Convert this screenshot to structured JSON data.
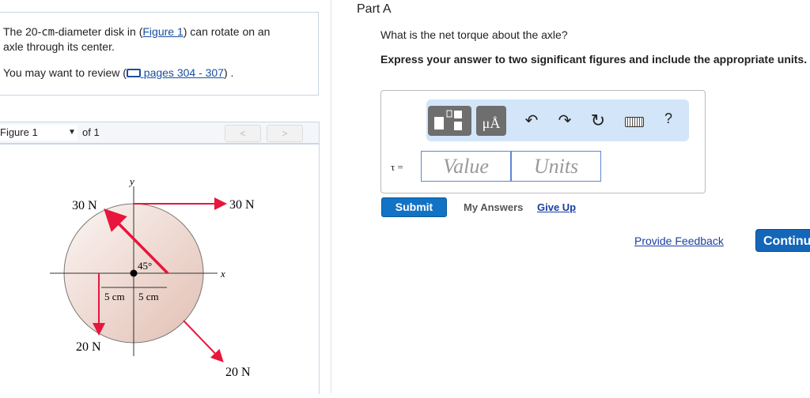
{
  "intro": {
    "line1a": "The 20-",
    "line1b": "cm",
    "line1c": "-diameter disk in (",
    "figure_link": "Figure 1",
    "line1d": ") can rotate on an",
    "line2": "axle through its center.",
    "review_a": "You may want to review (",
    "review_link": " pages 304 - 307",
    "review_b": ") ."
  },
  "figure_bar": {
    "select": "Figure 1",
    "of": "of 1",
    "prev": "<",
    "next": ">"
  },
  "diagram": {
    "y_axis": "y",
    "x_axis": "x",
    "f1": "30 N",
    "f2": "30 N",
    "f3": "20 N",
    "f4": "20 N",
    "angle": "45°",
    "d1": "5 cm",
    "d2": "5 cm"
  },
  "part": {
    "title": "Part A",
    "question": "What is the net torque about the axle?",
    "instruction": "Express your answer to two significant figures and include the appropriate units."
  },
  "answer": {
    "units_btn": "μÅ",
    "help": "?",
    "label": "τ =",
    "value_placeholder": "Value",
    "units_placeholder": "Units"
  },
  "actions": {
    "submit": "Submit",
    "my_answers": "My Answers",
    "give_up": "Give Up",
    "feedback": "Provide Feedback",
    "continue": "Continue"
  },
  "colors": {
    "force": "#e8163c",
    "accent": "#1272c4"
  }
}
